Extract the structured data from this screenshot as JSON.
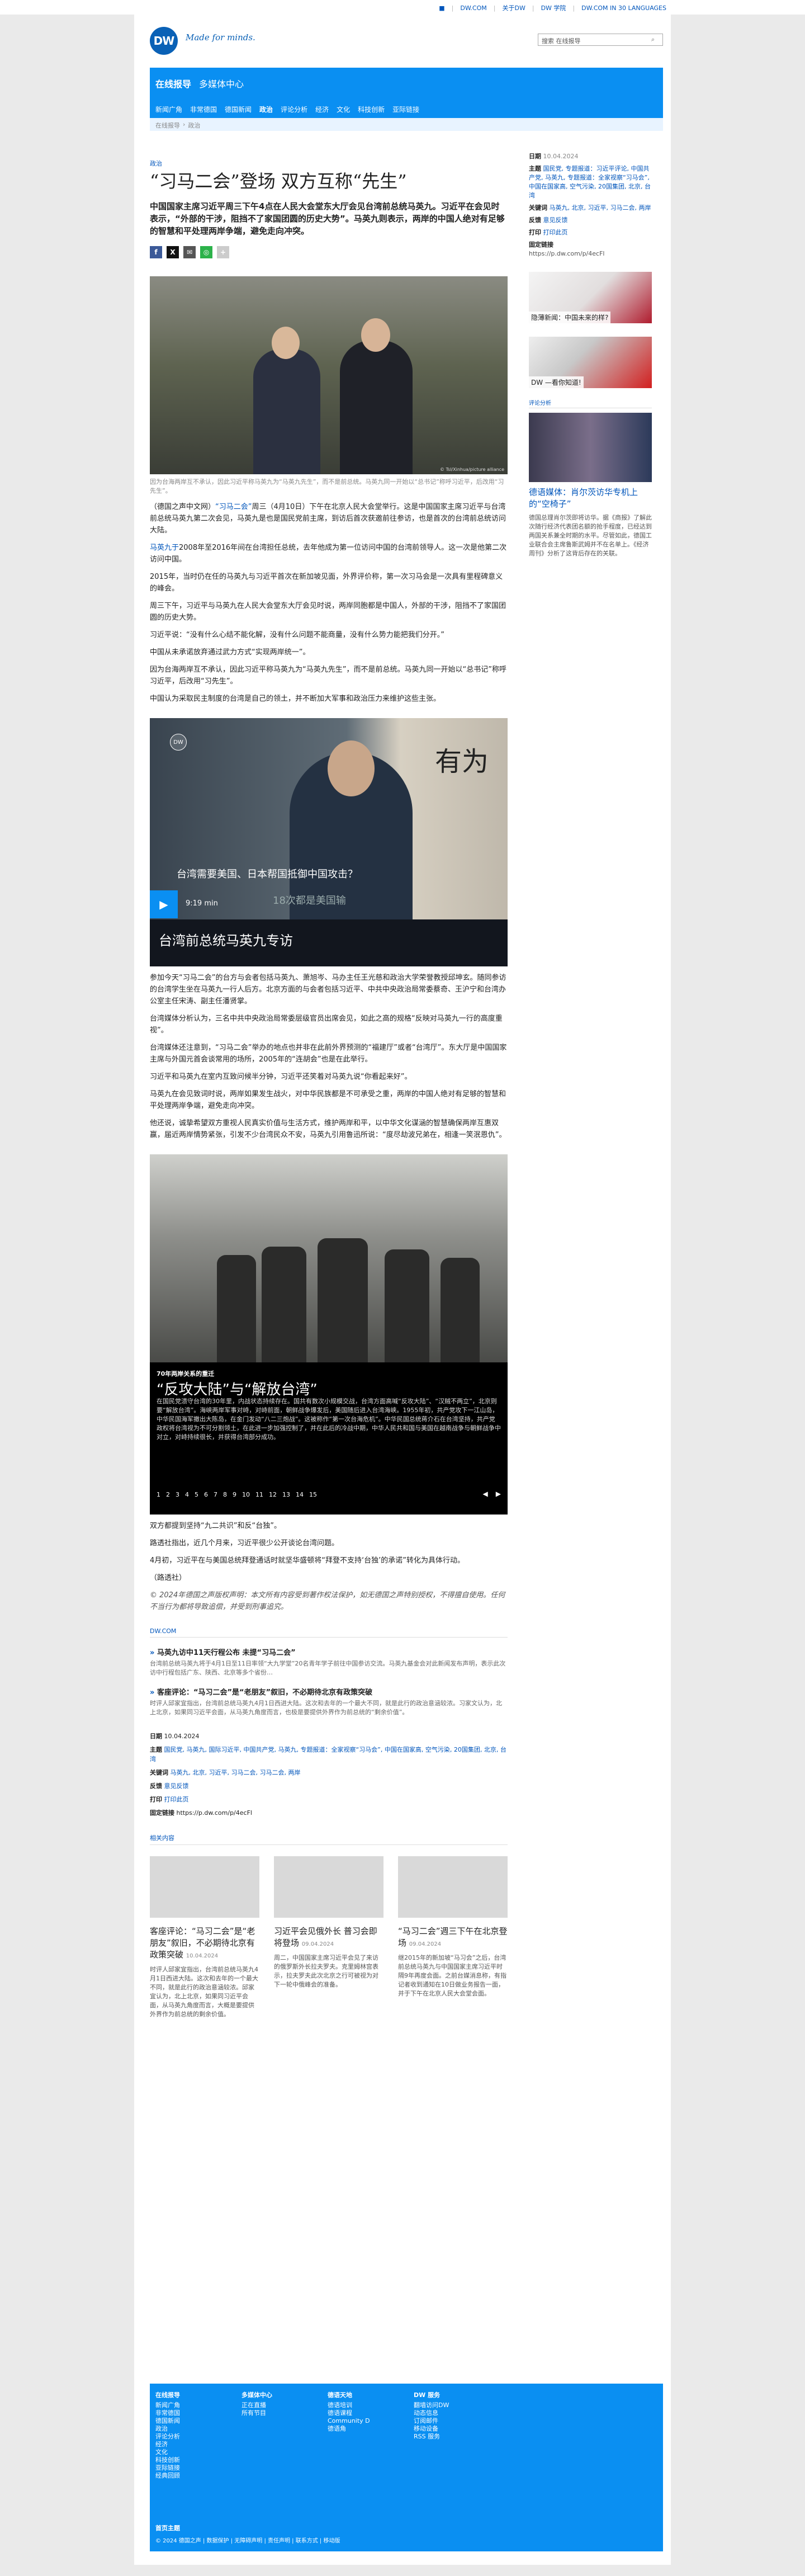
{
  "topstrip": {
    "links": [
      "DW.COM",
      "关于DW",
      "DW 学院",
      "DW.COM IN 30 LANGUAGES"
    ]
  },
  "header": {
    "logo": "DW",
    "tagline": "Made for minds.",
    "search_placeholder": "搜索 在线报导"
  },
  "nav": {
    "title": "在线报导",
    "media": "多媒体中心",
    "items": [
      "新闻广角",
      "非常德国",
      "德国新闻",
      "政治",
      "评论分析",
      "经济",
      "文化",
      "科技创新",
      "亚际链接"
    ],
    "active_index": 3,
    "breadcrumb": [
      "在线报导",
      "政治"
    ]
  },
  "article": {
    "kicker": "政治",
    "title": "“习马二会”登场 双方互称“先生”",
    "lead": "中国国家主席习近平周三下午4点在人民大会堂东大厅会见台湾前总统马英九。习近平在会见时表示，“外部的干涉，阻挡不了家国团圆的历史大势”。马英九则表示，两岸的中国人绝对有足够的智慧和平处理两岸争端，避免走向冲突。",
    "photo_credit": "© Tsl/Xinhua/picture alliance",
    "photo_caption": "因为台海两岸互不承认，因此习近平称马英九为“马英九先生”，而不是前总统。马英九同一开始以“总书记”称呼习近平，后改用“习先生”。",
    "paragraphs": [
      {
        "pre": "（德国之声中文网）",
        "hl": "“习马二会”",
        "post": "周三（4月10日）下午在北京人民大会堂举行。这是中国国家主席习近平与台湾前总统马英九第二次会见，马英九是也是国民党前主席，到访后首次获邀前往参访，也是首次的台湾前总统访问大陆。"
      },
      {
        "pre": "",
        "hl": "马英九于",
        "post": "2008年至2016年间在台湾担任总统，去年他成为第一位访问中国的台湾前领导人。这一次是他第二次访问中国。"
      },
      {
        "pre": "",
        "hl": "",
        "post": "2015年，当时仍在任的马英九与习近平首次在新加坡见面，外界评价称，第一次习马会是一次具有里程碑意义的峰会。"
      },
      {
        "pre": "",
        "hl": "",
        "post": "周三下午，习近平与马英九在人民大会堂东大厅会见时说，两岸同胞都是中国人，外部的干涉，阻挡不了家国团圆的历史大势。"
      },
      {
        "pre": "",
        "hl": "",
        "post": "习近平说：“没有什么心结不能化解，没有什么问题不能商量，没有什么势力能把我们分开。”"
      },
      {
        "pre": "",
        "hl": "",
        "post": "中国从未承诺放弃通过武力方式“实现两岸统一”。"
      },
      {
        "pre": "",
        "hl": "",
        "post": "因为台海两岸互不承认，因此习近平称马英九为“马英九先生”，而不是前总统。马英九同一开始以“总书记”称呼习近平，后改用“习先生”。"
      },
      {
        "pre": "",
        "hl": "",
        "post": "中国认为采取民主制度的台湾是自己的领土，并不断加大军事和政治压力来维护这些主张。"
      }
    ],
    "video": {
      "badge": "DW",
      "calligraphy": "有为",
      "sub1": "台湾需要美国、日本帮国抵御中国攻击？",
      "sub2": "18次都是美国输",
      "duration": "9:19 min",
      "title": "台湾前总统马英九专访"
    },
    "paragraphs2": [
      "参加今天“习马二会”的台方与会者包括马英九、萧旭岑、马办主任王光慈和政治大学荣誉教授邱坤玄。随同参访的台湾学生坐在马英九一行人后方。北京方面的与会者包括习近平、中共中央政治局常委蔡奇、王沪宁和台湾办公室主任宋涛、副主任潘贤掌。",
      "台湾媒体分析认为，三名中共中央政治局常委层级官员出席会见，如此之高的规格“反映对马英九一行的高度重视”。",
      "台湾媒体还注意到，“习马二会”举办的地点也并非在此前外界预测的“福建厅”或者“台湾厅”。东大厅是中国国家主席与外国元首会谈常用的场所，2005年的“连胡会”也是在此举行。",
      "习近平和马英九在室内互致问候半分钟，习近平还笑着对马英九说“你看起来好”。",
      "马英九在会见致词时说，两岸如果发生战火，对中华民族都是不可承受之重，两岸的中国人绝对有足够的智慧和平处理两岸争端，避免走向冲突。",
      "他还说，诚挚希望双方重视人民真实价值与生活方式，维护两岸和平，以中华文化谋涵的智慧确保两岸互惠双赢，届近两岸情势紧张，引发不少台湾民众不安，马英九引用鲁迅所说：“度尽劫波兄弟在，相逢一笑泯恩仇”。"
    ],
    "gallery": {
      "kicker": "70年两岸关系的重迁",
      "title": "“反攻大陆”与“解放台湾”",
      "text": "在国民党溃守台湾的30年里，内战状态持续存在。国共有数次小规模交战，台湾方面高喊“反攻大陆”、“汉贼不两立”，北京则要“解放台湾”。海峡两岸军事对峙，对峙前面，朝鲜战争爆发后，美国随后进入台湾海峡。1955年初，共产党攻下一江山岛，中华民国海军撤出大陈岛，在金门发动“八二三炮战”。这被称作“第一次台海危机”。中华民国总统蒋介石在台湾坚持，共产党政权将台湾视为不可分割领土，在此进一步加强控制了，并在此后的冷战中期，中华人民共和国与美国在越南战争与朝鲜战争中对立，对峙持续很长，并获得台湾部分成功。",
      "pages": [
        "1",
        "2",
        "3",
        "4",
        "5",
        "6",
        "7",
        "8",
        "9",
        "10",
        "11",
        "12",
        "13",
        "14",
        "15"
      ]
    },
    "paragraphs3": [
      "双方都提到坚持“九二共识”和反“台独”。",
      "路透社指出，近几个月来，习近平很少公开谈论台湾问题。",
      "4月初，习近平在与美国总统拜登通话时就坚华盛顿将“拜登不支持‘台独’的承诺”转化为具体行动。",
      "（路透社）"
    ],
    "copyright": "© 2024年德国之声版权声明：本文所有内容受到著作权法保护，如无德国之声特别授权，不得擅自使用。任何不当行为都将导致追偿，并受到刑事追究。",
    "dw_header": "DW.COM",
    "teasers": [
      {
        "title": "马英九访中11天行程公布 未提“习马二会”",
        "desc": "台湾前总统马英九将于4月1日至11日率领“大九学堂”20名青年学子前往中国参访交流。马英九基金会对此新闻发布声明，表示此次访中行程包括广东、陕西、北京等多个省份…"
      },
      {
        "title": "客座评论：“马习二会”是“老朋友”叙旧，不必期待北京有政策突破",
        "desc": "时评人邱家宜指出，台湾前总统马英九4月1日西进大陆。这次和去年的一个最大不同，就是此行的政治意涵较浓。习家文认为，北上北京，如果同习近平会面，从马英九角度而言，也极是要提供外界作为前总统的“剩余价值”。"
      }
    ],
    "meta": {
      "date_label": "日期",
      "date": "10.04.2024",
      "topics_label": "主题",
      "topics": "国民党, 马英九, 国际习近平, 中国共产党, 马英九, 专题报道：全家视察“习马会”, 中国在国家高, 空气污染, 20国集团, 北京, 台湾",
      "keywords_label": "关键词",
      "keywords": "马英九, 北京, 习近平, 习马二会, 习马二会, 两岸",
      "feedback_label": "反馈",
      "feedback": "意见反馈",
      "print_label": "打印",
      "print": "打印此页",
      "permalink_label": "固定链接",
      "permalink": "https://p.dw.com/p/4ecFl"
    },
    "related_header": "相关内容",
    "related": [
      {
        "title": "客座评论：“马习二会”是“老朋友”叙旧，不必期待北京有政策突破",
        "date": "10.04.2024",
        "desc": "时评人邱家宜指出，台湾前总统马英九4月1日西进大陆。这次和去年的一个最大不同，就是此行的政治意涵较浓。邱家宜认为，北上北京，如果同习近平会面，从马英九角度而言，大概是要提供外界作为前总统的剩余价值。"
      },
      {
        "title": "习近平会见俄外长 普习会即将登场",
        "date": "09.04.2024",
        "desc": "周二，中国国家主席习近平会见了来访的俄罗斯外长拉夫罗夫。克里姆林宫表示，拉夫罗夫此次北京之行可被视为对下一轮中俄峰会的准备。"
      },
      {
        "title": "“马习二会”週三下午在北京登场",
        "date": "09.04.2024",
        "desc": "继2015年的新加坡“马习会”之后，台湾前总统马英九与中国国家主席习近平时隔9年再度会面。之前台媒消息称，有指记者收到通知在10日做业务报告一面，并于下午在北京人民大会堂会面。"
      }
    ]
  },
  "sidebar": {
    "date_label": "日期",
    "date": "10.04.2024",
    "topics_label": "主题",
    "topics": "国民党, 专题报道：习近平评论, 中国共产党, 马英九, 专题报道：全家视察“习马会”, 中国在国家高, 空气污染, 20国集团, 北京, 台湾",
    "keywords_label": "关键词",
    "keywords": "马英九, 北京, 习近平, 习马二会, 两岸",
    "feedback_label": "反馈",
    "feedback": "意见反馈",
    "print_label": "打印",
    "print": "打印此页",
    "permalink_label": "固定链接",
    "permalink": "https://p.dw.com/p/4ecFl",
    "promo1": "隐薄新闻：中国未来的样?",
    "promo2": "DW —看你知道!",
    "analysis_header": "评论分析",
    "article_title": "德语媒体：肖尔茨访华专机上的“空椅子”",
    "article_desc": "德国总理肖尔茨即将访华。据《商报》了解此次随行经济代表团名额的抢手程度，已经达到两国关系兼全时期的水平。尽管如此，德国工业联合会主席鲁斯武姆并不在名单上。《经济周刊》分析了这背后存在的关联。"
  },
  "footer": {
    "cols": [
      {
        "h": "在线报导",
        "items": [
          "新闻广角",
          "非常德国",
          "德国新闻",
          "政治",
          "评论分析",
          "经济",
          "文化",
          "科技创新",
          "亚际链接",
          "经典回顾"
        ]
      },
      {
        "h": "多媒体中心",
        "items": [
          "正在直播",
          "所有节目"
        ]
      },
      {
        "h": "德语天地",
        "items": [
          "德语培训",
          "德语课程",
          "Community D",
          "德语角"
        ]
      },
      {
        "h": "DW 服务",
        "items": [
          "翻墙访问DW",
          "动态信息",
          "订阅邮件",
          "移动设备",
          "RSS 服务"
        ]
      }
    ],
    "main": "首页主题",
    "bottom": "© 2024 德国之声 | 数据保护 | 无障碍声明 | 责任声明 | 联系方式 | 移动版"
  }
}
